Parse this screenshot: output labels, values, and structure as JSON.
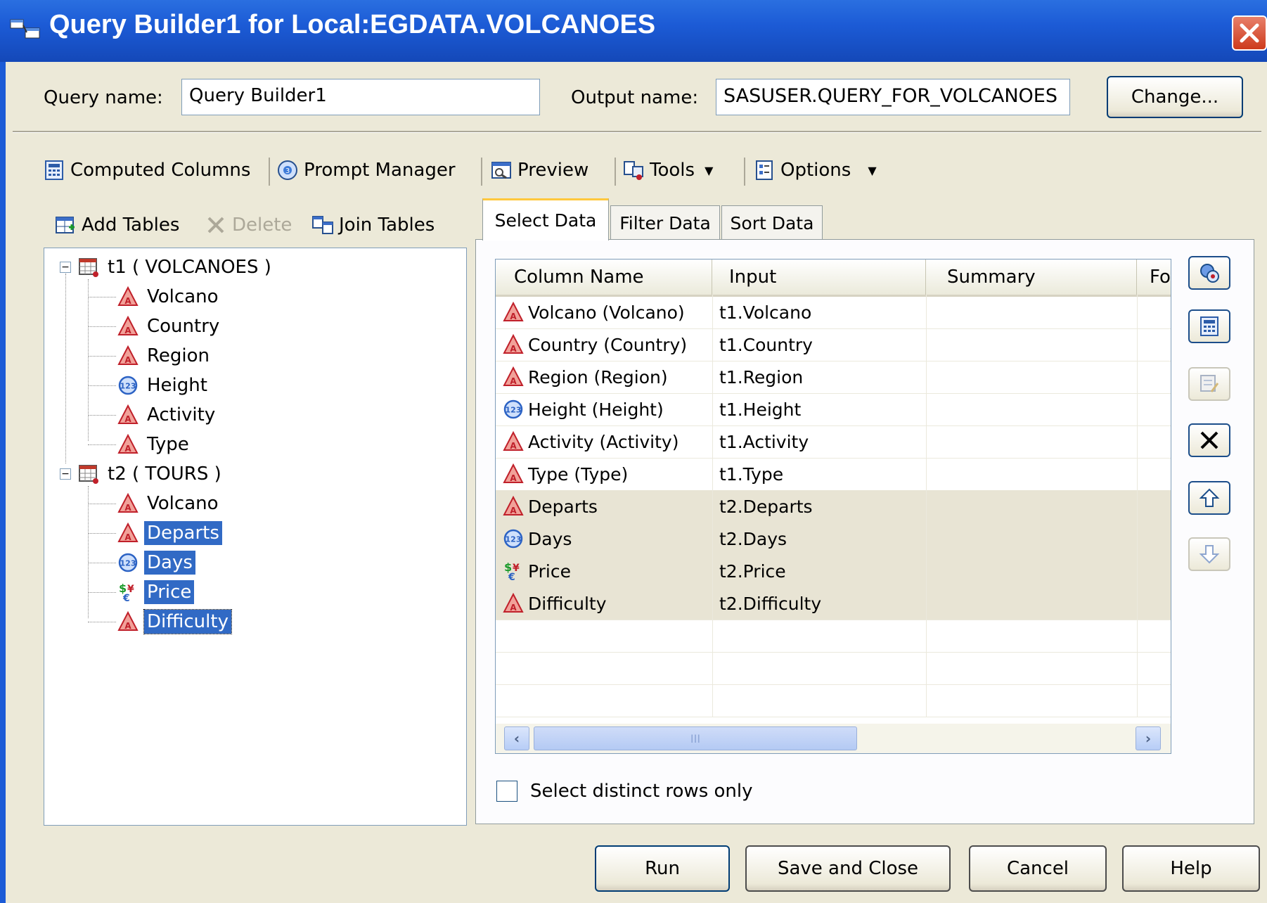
{
  "window": {
    "title": "Query Builder1 for Local:EGDATA.VOLCANOES",
    "accent": "#1c5bd6",
    "selection_color": "#316ac5"
  },
  "header": {
    "query_name_label": "Query name:",
    "query_name_value": "Query Builder1",
    "output_name_label": "Output name:",
    "output_name_value": "SASUSER.QUERY_FOR_VOLCANOES",
    "change_button": "Change..."
  },
  "toolbar": {
    "computed_columns": "Computed Columns",
    "prompt_manager": "Prompt Manager",
    "preview": "Preview",
    "tools": "Tools",
    "options": "Options"
  },
  "left_toolbar": {
    "add_tables": "Add Tables",
    "delete": "Delete",
    "join_tables": "Join Tables"
  },
  "tree": {
    "tables": [
      {
        "label": "t1 ( VOLCANOES )",
        "columns": [
          {
            "label": "Volcano",
            "icon": "character-column-icon",
            "selected": false
          },
          {
            "label": "Country",
            "icon": "character-column-icon",
            "selected": false
          },
          {
            "label": "Region",
            "icon": "character-column-icon",
            "selected": false
          },
          {
            "label": "Height",
            "icon": "numeric-column-icon",
            "selected": false
          },
          {
            "label": "Activity",
            "icon": "character-column-icon",
            "selected": false
          },
          {
            "label": "Type",
            "icon": "character-column-icon",
            "selected": false
          }
        ]
      },
      {
        "label": "t2 ( TOURS )",
        "columns": [
          {
            "label": "Volcano",
            "icon": "character-column-icon",
            "selected": false
          },
          {
            "label": "Departs",
            "icon": "character-column-icon",
            "selected": true
          },
          {
            "label": "Days",
            "icon": "numeric-column-icon",
            "selected": true
          },
          {
            "label": "Price",
            "icon": "currency-column-icon",
            "selected": true
          },
          {
            "label": "Difficulty",
            "icon": "character-column-icon",
            "selected": true
          }
        ]
      }
    ]
  },
  "tabs": [
    "Select Data",
    "Filter Data",
    "Sort Data"
  ],
  "grid": {
    "headers": [
      "Column Name",
      "Input",
      "Summary",
      "Fo"
    ],
    "rows": [
      {
        "name": "Volcano (Volcano)",
        "input": "t1.Volcano",
        "icon": "character-column-icon"
      },
      {
        "name": "Country (Country)",
        "input": "t1.Country",
        "icon": "character-column-icon"
      },
      {
        "name": "Region (Region)",
        "input": "t1.Region",
        "icon": "character-column-icon"
      },
      {
        "name": "Height (Height)",
        "input": "t1.Height",
        "icon": "numeric-column-icon"
      },
      {
        "name": "Activity (Activity)",
        "input": "t1.Activity",
        "icon": "character-column-icon"
      },
      {
        "name": "Type (Type)",
        "input": "t1.Type",
        "icon": "character-column-icon"
      },
      {
        "name": "Departs",
        "input": "t2.Departs",
        "icon": "character-column-icon"
      },
      {
        "name": "Days",
        "input": "t2.Days",
        "icon": "numeric-column-icon"
      },
      {
        "name": "Price",
        "input": "t2.Price",
        "icon": "currency-column-icon"
      },
      {
        "name": "Difficulty",
        "input": "t2.Difficulty",
        "icon": "character-column-icon"
      }
    ],
    "scroll_glyph": "III"
  },
  "side_buttons": [
    "properties-icon",
    "computed-column-icon",
    "edit-icon",
    "delete-icon",
    "move-up-icon",
    "move-down-icon"
  ],
  "distinct": {
    "label": "Select distinct rows only",
    "checked": false
  },
  "footer": {
    "run": "Run",
    "save_close": "Save and Close",
    "cancel": "Cancel",
    "help": "Help"
  }
}
